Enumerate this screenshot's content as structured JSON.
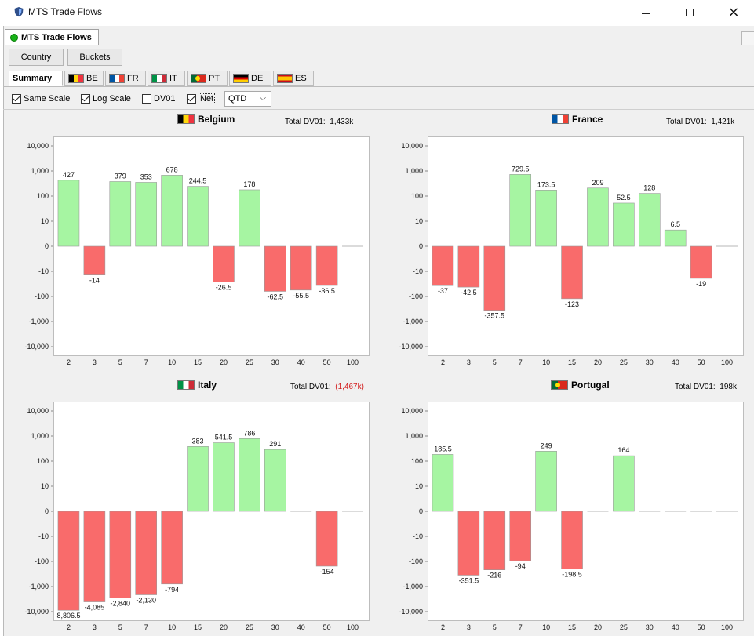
{
  "window": {
    "title": "MTS Trade Flows",
    "controls": {
      "minimize": "–",
      "maximize": "□",
      "close": "×"
    }
  },
  "doc_tab": {
    "label": "MTS Trade Flows",
    "status_color": "#18b218"
  },
  "view_buttons": {
    "country": "Country",
    "buckets": "Buckets"
  },
  "country_tabs": [
    {
      "label": "Summary",
      "flag": null,
      "active": true
    },
    {
      "label": "BE",
      "flag": "belgium-flag"
    },
    {
      "label": "FR",
      "flag": "france-flag"
    },
    {
      "label": "IT",
      "flag": "italy-flag"
    },
    {
      "label": "PT",
      "flag": "portugal-flag"
    },
    {
      "label": "DE",
      "flag": "germany-flag"
    },
    {
      "label": "ES",
      "flag": "spain-flag"
    }
  ],
  "options": {
    "same_scale": {
      "label": "Same Scale",
      "checked": true
    },
    "log_scale": {
      "label": "Log Scale",
      "checked": true
    },
    "dv01": {
      "label": "DV01",
      "checked": false
    },
    "net": {
      "label": "Net",
      "checked": true
    },
    "period": {
      "value": "QTD"
    }
  },
  "colors": {
    "positive": "#a6f5a2",
    "negative": "#f96b6b",
    "negative_text": "#d32020"
  },
  "dv01_label": "Total DV01:",
  "chart_data": [
    {
      "type": "bar",
      "title": "Belgium",
      "total_dv01": "1,433k",
      "total_negative": false,
      "scale": "symlog",
      "yticks": [
        "10,000",
        "1,000",
        "100",
        "10",
        "0",
        "-10",
        "-100",
        "-1,000",
        "-10,000"
      ],
      "categories": [
        "2",
        "3",
        "5",
        "7",
        "10",
        "15",
        "20",
        "25",
        "30",
        "40",
        "50",
        "100"
      ],
      "values": [
        427,
        -14,
        379,
        353,
        678,
        244.5,
        -26.5,
        178,
        -62.5,
        -55.5,
        -36.5,
        0
      ],
      "labels": [
        "427",
        "-14",
        "379",
        "353",
        "678",
        "244.5",
        "-26.5",
        "178",
        "-62.5",
        "-55.5",
        "-36.5",
        ""
      ]
    },
    {
      "type": "bar",
      "title": "France",
      "total_dv01": "1,421k",
      "total_negative": false,
      "scale": "symlog",
      "yticks": [
        "10,000",
        "1,000",
        "100",
        "10",
        "0",
        "-10",
        "-100",
        "-1,000",
        "-10,000"
      ],
      "categories": [
        "2",
        "3",
        "5",
        "7",
        "10",
        "15",
        "20",
        "25",
        "30",
        "40",
        "50",
        "100"
      ],
      "values": [
        -37,
        -42.5,
        -357.5,
        729.5,
        173.5,
        -123,
        209,
        52.5,
        128,
        6.5,
        -19,
        0
      ],
      "labels": [
        "-37",
        "-42.5",
        "-357.5",
        "729.5",
        "173.5",
        "-123",
        "209",
        "52.5",
        "128",
        "6.5",
        "-19",
        ""
      ]
    },
    {
      "type": "bar",
      "title": "Italy",
      "total_dv01": "(1,467k)",
      "total_negative": true,
      "scale": "symlog",
      "yticks": [
        "10,000",
        "1,000",
        "100",
        "10",
        "0",
        "-10",
        "-100",
        "-1,000",
        "-10,000"
      ],
      "categories": [
        "2",
        "3",
        "5",
        "7",
        "10",
        "15",
        "20",
        "25",
        "30",
        "40",
        "50",
        "100"
      ],
      "values": [
        -8806.5,
        -4085,
        -2840,
        -2130,
        -794,
        383,
        541.5,
        786,
        291,
        0,
        -154,
        0
      ],
      "labels": [
        "8,806.5",
        "-4,085",
        "-2,840",
        "-2,130",
        "-794",
        "383",
        "541.5",
        "786",
        "291",
        "",
        "-154",
        ""
      ]
    },
    {
      "type": "bar",
      "title": "Portugal",
      "total_dv01": "198k",
      "total_negative": false,
      "scale": "symlog",
      "yticks": [
        "10,000",
        "1,000",
        "100",
        "10",
        "0",
        "-10",
        "-100",
        "-1,000",
        "-10,000"
      ],
      "categories": [
        "2",
        "3",
        "5",
        "7",
        "10",
        "15",
        "20",
        "25",
        "30",
        "40",
        "50",
        "100"
      ],
      "values": [
        185.5,
        -351.5,
        -216,
        -94,
        249,
        -198.5,
        0,
        164,
        0,
        0,
        0,
        0
      ],
      "labels": [
        "185.5",
        "-351.5",
        "-216",
        "-94",
        "249",
        "-198.5",
        "",
        "164",
        "",
        "",
        "",
        ""
      ]
    }
  ]
}
